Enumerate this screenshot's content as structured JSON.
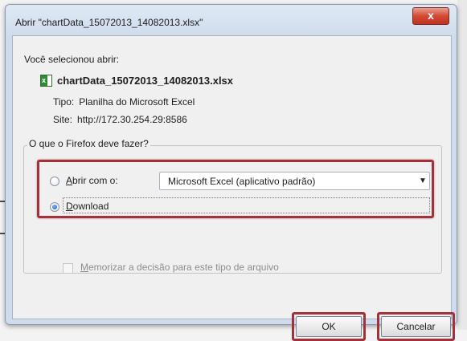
{
  "dialog": {
    "title": "Abrir \"chartData_15072013_14082013.xlsx\"",
    "close_glyph": "x",
    "selected_label": "Você selecionou abrir:",
    "file_name": "chartData_15072013_14082013.xlsx",
    "type_label": "Tipo:",
    "type_value": "Planilha do Microsoft Excel",
    "site_label": "Site:",
    "site_value": "http://172.30.254.29:8586"
  },
  "action_group": {
    "legend": "O que o Firefox deve fazer?",
    "open_with": {
      "mnemonic": "A",
      "label_rest": "brir com o:",
      "selected": false
    },
    "app_select": {
      "value": "Microsoft Excel (aplicativo padrão)"
    },
    "download": {
      "mnemonic": "D",
      "label_rest": "ownload",
      "selected": true
    },
    "remember": {
      "mnemonic": "M",
      "label_rest": "emorizar a decisão para este tipo de arquivo",
      "checked": false,
      "enabled": false
    }
  },
  "buttons": {
    "ok": "OK",
    "cancel": "Cancelar"
  },
  "colors": {
    "highlight": "#a3313a",
    "close": "#c2321f"
  }
}
